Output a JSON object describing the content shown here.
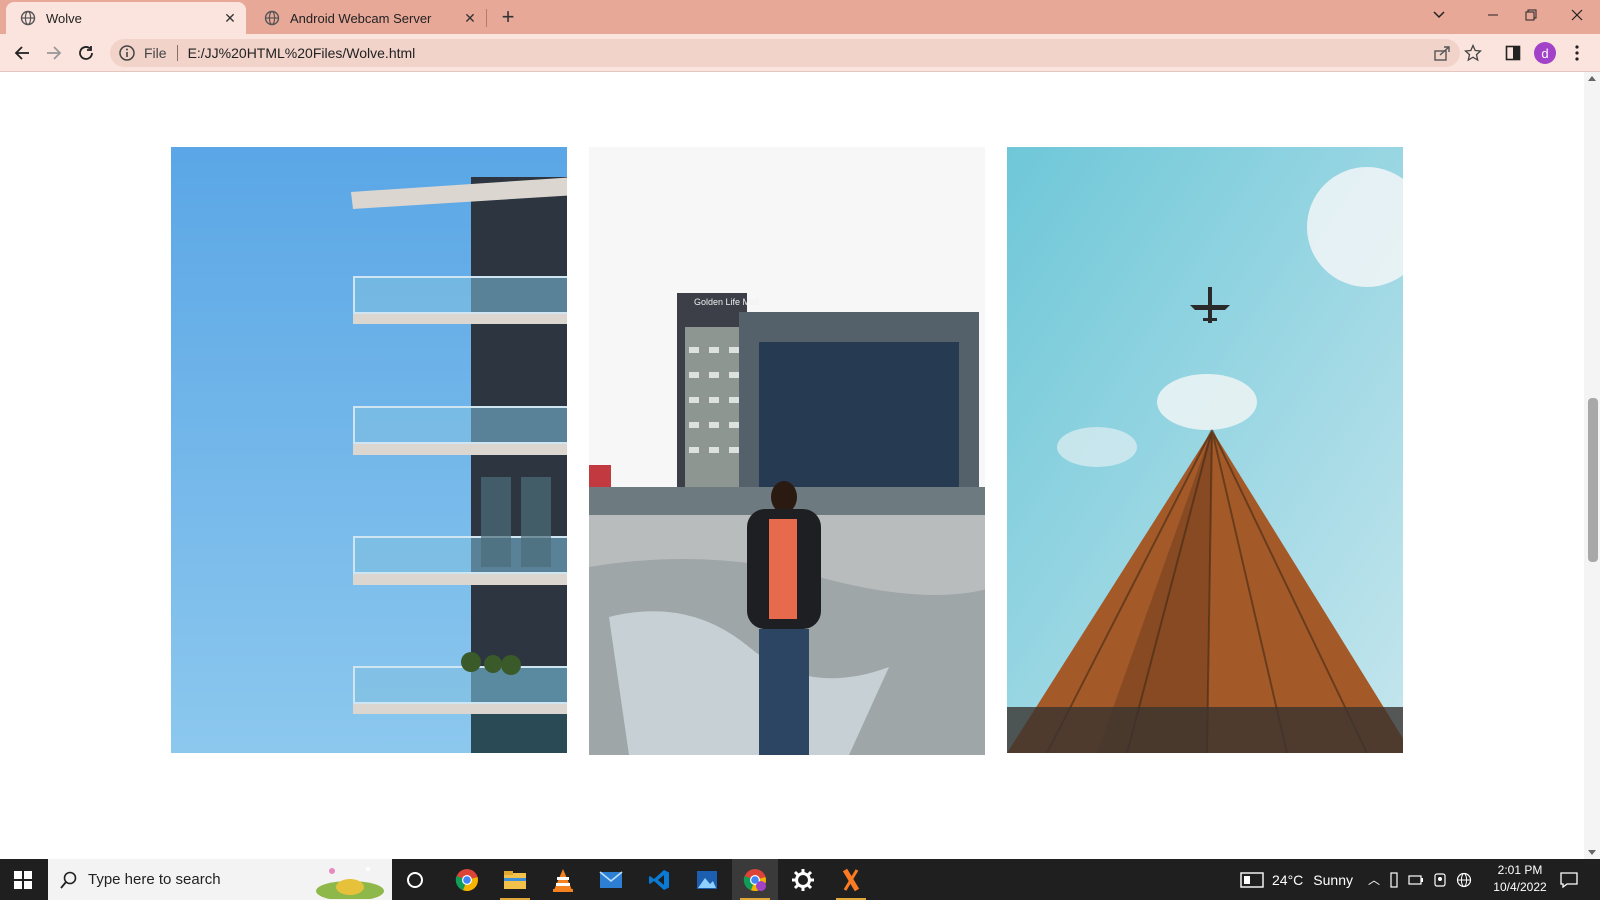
{
  "browser": {
    "tabs": [
      {
        "title": "Wolve",
        "active": true
      },
      {
        "title": "Android Webcam Server",
        "active": false
      }
    ],
    "address": {
      "scheme": "File",
      "url": "E:/JJ%20HTML%20Files/Wolve.html"
    },
    "profile_initial": "d"
  },
  "page": {
    "photos": [
      {
        "subject": "modern building balconies against blue sky"
      },
      {
        "subject": "man standing before Golden Life Mall",
        "sign_text": "Golden Life Mall"
      },
      {
        "subject": "skyscraper from below with airplane overhead"
      }
    ]
  },
  "taskbar": {
    "search_placeholder": "Type here to search",
    "apps": [
      "cortana-icon",
      "chrome-icon",
      "file-explorer-icon",
      "vlc-icon",
      "mail-icon",
      "vscode-icon",
      "photos-icon",
      "chrome-profile-icon",
      "settings-icon",
      "xampp-icon"
    ],
    "weather": {
      "temp": "24°C",
      "condition": "Sunny"
    },
    "time": "2:01 PM",
    "date": "10/4/2022"
  },
  "colors": {
    "tab_strip": "#e8a898",
    "toolbar": "#fbe4dd",
    "accent_profile": "#a142c8"
  }
}
